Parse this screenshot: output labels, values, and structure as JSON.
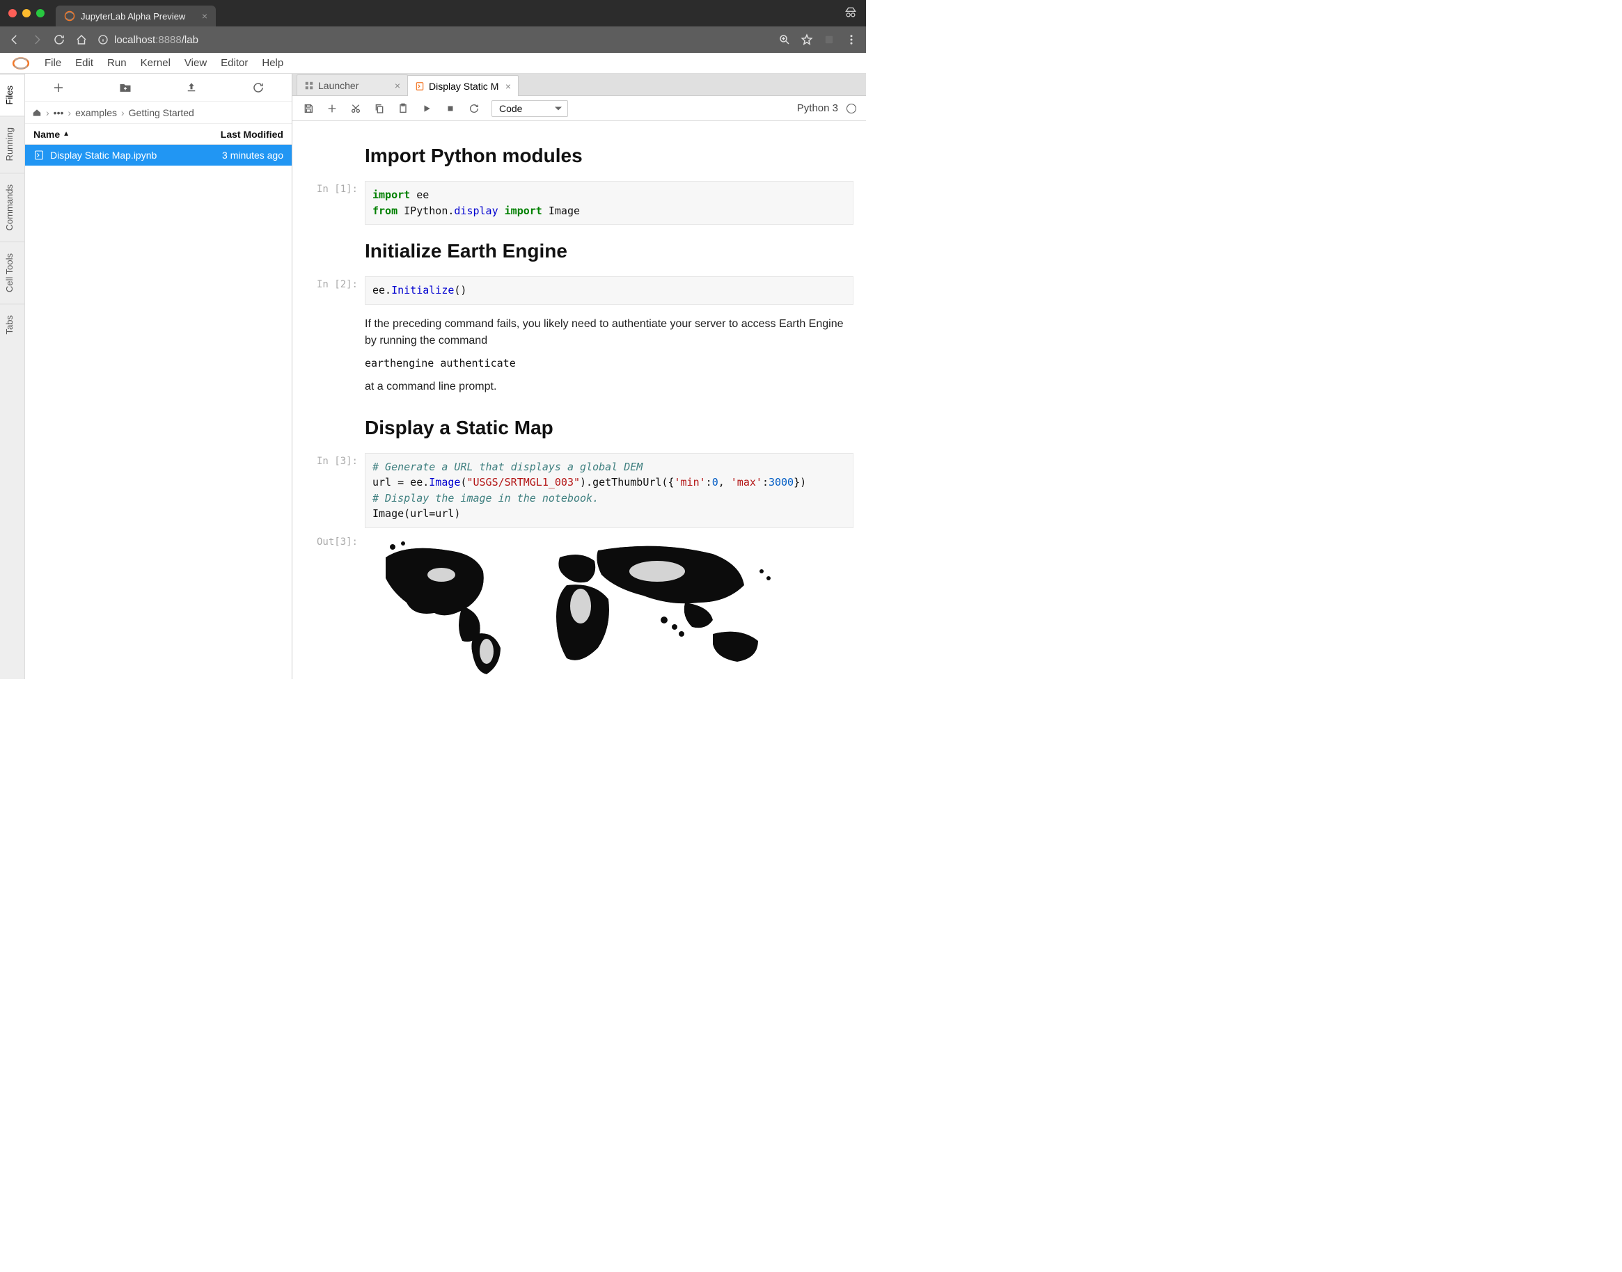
{
  "browser": {
    "tab_title": "JupyterLab Alpha Preview",
    "url_host": "localhost",
    "url_port": ":8888",
    "url_path": "/lab"
  },
  "menubar": [
    "File",
    "Edit",
    "Run",
    "Kernel",
    "View",
    "Editor",
    "Help"
  ],
  "left_rail": [
    "Files",
    "Running",
    "Commands",
    "Cell Tools",
    "Tabs"
  ],
  "filebrowser": {
    "breadcrumb": [
      "examples",
      "Getting Started"
    ],
    "columns": {
      "name": "Name",
      "last_modified": "Last Modified"
    },
    "rows": [
      {
        "name": "Display Static Map.ipynb",
        "last_modified": "3 minutes ago",
        "selected": true
      }
    ]
  },
  "doctabs": [
    {
      "label": "Launcher",
      "active": false,
      "icon": "launcher"
    },
    {
      "label": "Display Static M",
      "active": true,
      "icon": "notebook"
    }
  ],
  "nb_toolbar": {
    "cell_type": "Code",
    "kernel": "Python 3"
  },
  "cells": [
    {
      "type": "md",
      "h2": "Import Python modules"
    },
    {
      "type": "code",
      "prompt": "In [1]:",
      "code": "import ee\nfrom IPython.display import Image"
    },
    {
      "type": "md",
      "h2": "Initialize Earth Engine"
    },
    {
      "type": "code",
      "prompt": "In [2]:",
      "code": "ee.Initialize()"
    },
    {
      "type": "md",
      "p1": "If the preceding command fails, you likely need to authentiate your server to access Earth Engine by running the command",
      "mono": "earthengine authenticate",
      "p2": "at a command line prompt."
    },
    {
      "type": "md",
      "h2": "Display a Static Map"
    },
    {
      "type": "code",
      "prompt": "In [3]:",
      "code": "# Generate a URL that displays a global DEM\nurl = ee.Image(\"USGS/SRTMGL1_003\").getThumbUrl({'min':0, 'max':3000})\n# Display the image in the notebook.\nImage(url=url)"
    },
    {
      "type": "out",
      "prompt": "Out[3]:"
    }
  ]
}
